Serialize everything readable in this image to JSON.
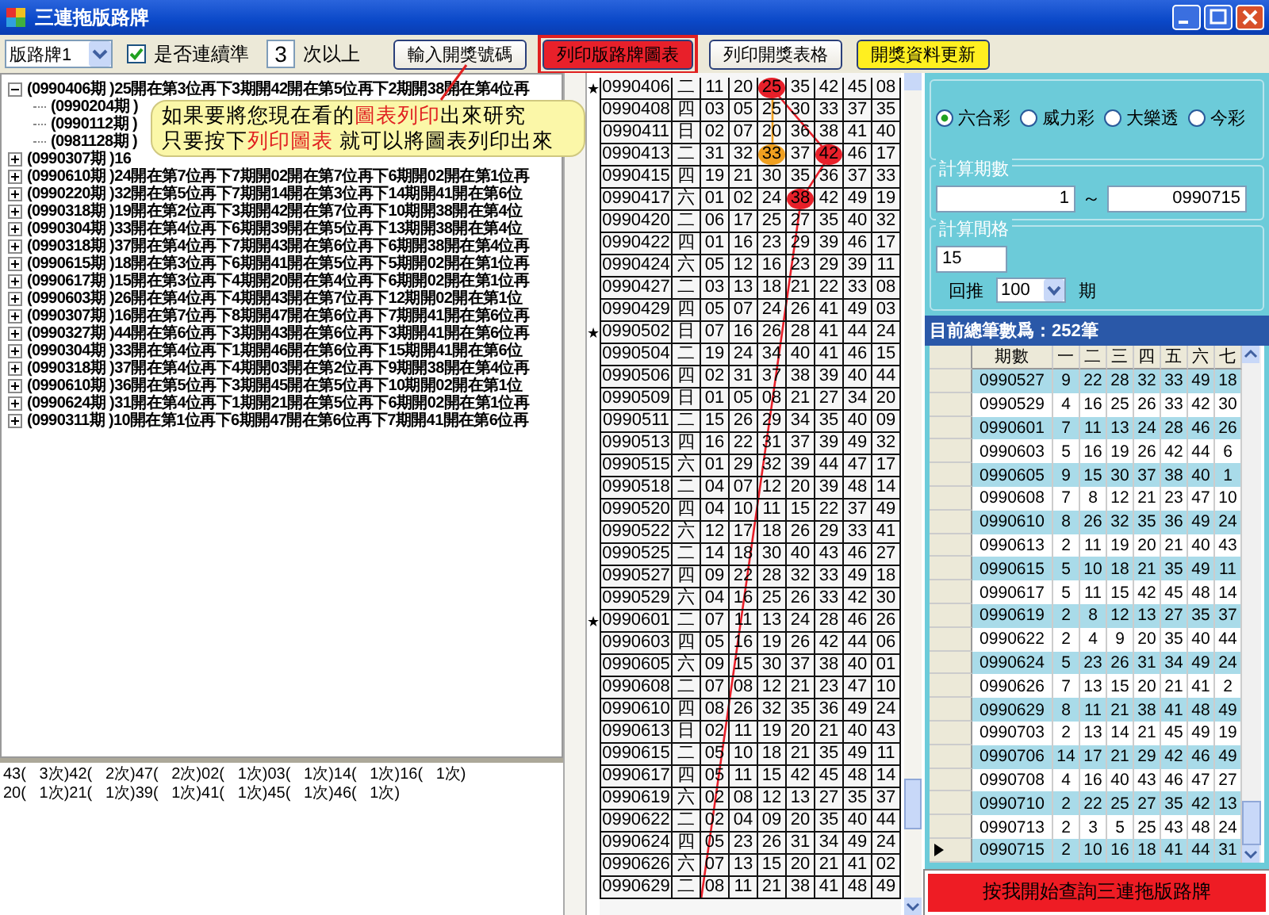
{
  "window": {
    "title": "三連拖版路牌"
  },
  "toolbar": {
    "dropdown": "版路牌1",
    "consecutive": {
      "label": "是否連續準",
      "checked": true
    },
    "count": "3",
    "count_suffix": "次以上",
    "buttons": [
      {
        "label": "輸入開獎號碼",
        "kind": "plain"
      },
      {
        "label": "列印版路牌圖表",
        "kind": "red"
      },
      {
        "label": "列印開獎表格",
        "kind": "plain"
      },
      {
        "label": "開獎資料更新",
        "kind": "yellow"
      }
    ]
  },
  "callout": {
    "lines": [
      [
        {
          "text": "如果要將您現在看的",
          "red": false
        },
        {
          "text": "圖表列印",
          "red": true
        },
        {
          "text": "出來研究",
          "red": false
        }
      ],
      [
        {
          "text": "只要按下",
          "red": false
        },
        {
          "text": "列印圖表",
          "red": true
        },
        {
          "text": " 就可以將圖表列印出來",
          "red": false
        }
      ]
    ]
  },
  "tree": [
    {
      "text": "(0990406期 )25開在第3位再下3期開42開在第5位再下2期開38開在第4位再",
      "expanded": true,
      "children": [
        {
          "text": "(0990204期 )"
        },
        {
          "text": "(0990112期 )"
        },
        {
          "text": "(0981128期 )"
        }
      ]
    },
    {
      "text": "(0990307期 )16",
      "expanded": false
    },
    {
      "text": "(0990610期 )24開在第7位再下7期開02開在第7位再下6期開02開在第1位再",
      "expanded": false
    },
    {
      "text": "(0990220期 )32開在第5位再下7期開14開在第3位再下14期開41開在第6位",
      "expanded": false
    },
    {
      "text": "(0990318期 )19開在第2位再下3期開42開在第7位再下10期開38開在第4位",
      "expanded": false
    },
    {
      "text": "(0990304期 )33開在第4位再下6期開39開在第5位再下13期開38開在第4位",
      "expanded": false
    },
    {
      "text": "(0990318期 )37開在第4位再下7期開43開在第6位再下6期開38開在第4位再",
      "expanded": false
    },
    {
      "text": "(0990615期 )18開在第3位再下6期開41開在第5位再下5期開02開在第1位再",
      "expanded": false
    },
    {
      "text": "(0990617期 )15開在第3位再下4期開20開在第4位再下6期開02開在第1位再",
      "expanded": false
    },
    {
      "text": "(0990603期 )26開在第4位再下4期開43開在第7位再下12期開02開在第1位",
      "expanded": false
    },
    {
      "text": "(0990307期 )16開在第7位再下8期開47開在第6位再下7期開41開在第6位再",
      "expanded": false
    },
    {
      "text": "(0990327期 )44開在第6位再下3期開43開在第6位再下3期開41開在第6位再",
      "expanded": false
    },
    {
      "text": "(0990304期 )33開在第4位再下1期開46開在第6位再下15期開41開在第6位",
      "expanded": false
    },
    {
      "text": "(0990318期 )37開在第4位再下4期開03開在第2位再下9期開38開在第4位再",
      "expanded": false
    },
    {
      "text": "(0990610期 )36開在第5位再下3期開45開在第5位再下10期開02開在第1位",
      "expanded": false
    },
    {
      "text": "(0990624期 )31開在第4位再下1期開21開在第5位再下6期開02開在第1位再",
      "expanded": false
    },
    {
      "text": "(0990311期 )10開在第1位再下6期開47開在第6位再下7期開41開在第6位再",
      "expanded": false
    }
  ],
  "summary": [
    "43(   3次)42(   2次)47(   2次)02(   1次)03(   1次)14(   1次)16(   1次)",
    "20(   1次)21(   1次)39(   1次)41(   1次)45(   1次)46(   1次)"
  ],
  "draws": {
    "rows": [
      {
        "marker": "★",
        "issue": "0990406",
        "weekday": "二",
        "numbers": [
          {
            "n": "11"
          },
          {
            "n": "20"
          },
          {
            "n": "25",
            "color": "#e8202a"
          },
          {
            "n": "35"
          },
          {
            "n": "42"
          },
          {
            "n": "45"
          },
          {
            "n": "08"
          }
        ]
      },
      {
        "issue": "0990408",
        "weekday": "四",
        "numbers": [
          {
            "n": "03"
          },
          {
            "n": "05"
          },
          {
            "n": "25"
          },
          {
            "n": "30"
          },
          {
            "n": "33"
          },
          {
            "n": "37"
          },
          {
            "n": "35"
          }
        ]
      },
      {
        "issue": "0990411",
        "weekday": "日",
        "numbers": [
          {
            "n": "02"
          },
          {
            "n": "07"
          },
          {
            "n": "20"
          },
          {
            "n": "36"
          },
          {
            "n": "38"
          },
          {
            "n": "41"
          },
          {
            "n": "40"
          }
        ]
      },
      {
        "issue": "0990413",
        "weekday": "二",
        "numbers": [
          {
            "n": "31"
          },
          {
            "n": "32"
          },
          {
            "n": "33",
            "color": "#f0a020"
          },
          {
            "n": "37"
          },
          {
            "n": "42",
            "color": "#e8202a"
          },
          {
            "n": "46"
          },
          {
            "n": "17"
          }
        ]
      },
      {
        "issue": "0990415",
        "weekday": "四",
        "numbers": [
          {
            "n": "19"
          },
          {
            "n": "21"
          },
          {
            "n": "30"
          },
          {
            "n": "35"
          },
          {
            "n": "36"
          },
          {
            "n": "37"
          },
          {
            "n": "33"
          }
        ]
      },
      {
        "issue": "0990417",
        "weekday": "六",
        "numbers": [
          {
            "n": "01"
          },
          {
            "n": "02"
          },
          {
            "n": "24"
          },
          {
            "n": "38",
            "color": "#e8202a"
          },
          {
            "n": "42"
          },
          {
            "n": "49"
          },
          {
            "n": "19"
          }
        ]
      },
      {
        "issue": "0990420",
        "weekday": "二",
        "numbers": [
          {
            "n": "06"
          },
          {
            "n": "17"
          },
          {
            "n": "25"
          },
          {
            "n": "27"
          },
          {
            "n": "35"
          },
          {
            "n": "40"
          },
          {
            "n": "32"
          }
        ]
      },
      {
        "issue": "0990422",
        "weekday": "四",
        "numbers": [
          {
            "n": "01"
          },
          {
            "n": "16"
          },
          {
            "n": "23"
          },
          {
            "n": "29"
          },
          {
            "n": "39"
          },
          {
            "n": "46"
          },
          {
            "n": "17"
          }
        ]
      },
      {
        "issue": "0990424",
        "weekday": "六",
        "numbers": [
          {
            "n": "05"
          },
          {
            "n": "12"
          },
          {
            "n": "16"
          },
          {
            "n": "23"
          },
          {
            "n": "29"
          },
          {
            "n": "39"
          },
          {
            "n": "11"
          }
        ]
      },
      {
        "issue": "0990427",
        "weekday": "二",
        "numbers": [
          {
            "n": "03"
          },
          {
            "n": "13"
          },
          {
            "n": "18"
          },
          {
            "n": "21"
          },
          {
            "n": "22"
          },
          {
            "n": "33"
          },
          {
            "n": "08"
          }
        ]
      },
      {
        "issue": "0990429",
        "weekday": "四",
        "numbers": [
          {
            "n": "05"
          },
          {
            "n": "07"
          },
          {
            "n": "24"
          },
          {
            "n": "26"
          },
          {
            "n": "41"
          },
          {
            "n": "49"
          },
          {
            "n": "03"
          }
        ]
      },
      {
        "marker": "★",
        "issue": "0990502",
        "weekday": "日",
        "numbers": [
          {
            "n": "07"
          },
          {
            "n": "16"
          },
          {
            "n": "26"
          },
          {
            "n": "28"
          },
          {
            "n": "41"
          },
          {
            "n": "44"
          },
          {
            "n": "24"
          }
        ]
      },
      {
        "issue": "0990504",
        "weekday": "二",
        "numbers": [
          {
            "n": "19"
          },
          {
            "n": "24"
          },
          {
            "n": "34"
          },
          {
            "n": "40"
          },
          {
            "n": "41"
          },
          {
            "n": "46"
          },
          {
            "n": "15"
          }
        ]
      },
      {
        "issue": "0990506",
        "weekday": "四",
        "numbers": [
          {
            "n": "02"
          },
          {
            "n": "31"
          },
          {
            "n": "37"
          },
          {
            "n": "38"
          },
          {
            "n": "39"
          },
          {
            "n": "40"
          },
          {
            "n": "44"
          }
        ]
      },
      {
        "issue": "0990509",
        "weekday": "日",
        "numbers": [
          {
            "n": "01"
          },
          {
            "n": "05"
          },
          {
            "n": "08"
          },
          {
            "n": "21"
          },
          {
            "n": "27"
          },
          {
            "n": "34"
          },
          {
            "n": "20"
          }
        ]
      },
      {
        "issue": "0990511",
        "weekday": "二",
        "numbers": [
          {
            "n": "15"
          },
          {
            "n": "26"
          },
          {
            "n": "29"
          },
          {
            "n": "34"
          },
          {
            "n": "35"
          },
          {
            "n": "40"
          },
          {
            "n": "09"
          }
        ]
      },
      {
        "issue": "0990513",
        "weekday": "四",
        "numbers": [
          {
            "n": "16"
          },
          {
            "n": "22"
          },
          {
            "n": "31"
          },
          {
            "n": "37"
          },
          {
            "n": "39"
          },
          {
            "n": "49"
          },
          {
            "n": "32"
          }
        ]
      },
      {
        "issue": "0990515",
        "weekday": "六",
        "numbers": [
          {
            "n": "01"
          },
          {
            "n": "29"
          },
          {
            "n": "32"
          },
          {
            "n": "39"
          },
          {
            "n": "44"
          },
          {
            "n": "47"
          },
          {
            "n": "17"
          }
        ]
      },
      {
        "issue": "0990518",
        "weekday": "二",
        "numbers": [
          {
            "n": "04"
          },
          {
            "n": "07"
          },
          {
            "n": "12"
          },
          {
            "n": "20"
          },
          {
            "n": "39"
          },
          {
            "n": "48"
          },
          {
            "n": "14"
          }
        ]
      },
      {
        "issue": "0990520",
        "weekday": "四",
        "numbers": [
          {
            "n": "04"
          },
          {
            "n": "10"
          },
          {
            "n": "11"
          },
          {
            "n": "15"
          },
          {
            "n": "22"
          },
          {
            "n": "37"
          },
          {
            "n": "49"
          }
        ]
      },
      {
        "issue": "0990522",
        "weekday": "六",
        "numbers": [
          {
            "n": "12"
          },
          {
            "n": "17"
          },
          {
            "n": "18"
          },
          {
            "n": "26"
          },
          {
            "n": "29"
          },
          {
            "n": "33"
          },
          {
            "n": "41"
          }
        ]
      },
      {
        "issue": "0990525",
        "weekday": "二",
        "numbers": [
          {
            "n": "14"
          },
          {
            "n": "18"
          },
          {
            "n": "30"
          },
          {
            "n": "40"
          },
          {
            "n": "43"
          },
          {
            "n": "46"
          },
          {
            "n": "27"
          }
        ]
      },
      {
        "issue": "0990527",
        "weekday": "四",
        "numbers": [
          {
            "n": "09"
          },
          {
            "n": "22"
          },
          {
            "n": "28"
          },
          {
            "n": "32"
          },
          {
            "n": "33"
          },
          {
            "n": "49"
          },
          {
            "n": "18"
          }
        ]
      },
      {
        "issue": "0990529",
        "weekday": "六",
        "numbers": [
          {
            "n": "04"
          },
          {
            "n": "16"
          },
          {
            "n": "25"
          },
          {
            "n": "26"
          },
          {
            "n": "33"
          },
          {
            "n": "42"
          },
          {
            "n": "30"
          }
        ]
      },
      {
        "marker": "★",
        "issue": "0990601",
        "weekday": "二",
        "numbers": [
          {
            "n": "07"
          },
          {
            "n": "11"
          },
          {
            "n": "13"
          },
          {
            "n": "24"
          },
          {
            "n": "28"
          },
          {
            "n": "46"
          },
          {
            "n": "26"
          }
        ]
      },
      {
        "issue": "0990603",
        "weekday": "四",
        "numbers": [
          {
            "n": "05"
          },
          {
            "n": "16"
          },
          {
            "n": "19"
          },
          {
            "n": "26"
          },
          {
            "n": "42"
          },
          {
            "n": "44"
          },
          {
            "n": "06"
          }
        ]
      },
      {
        "issue": "0990605",
        "weekday": "六",
        "numbers": [
          {
            "n": "09"
          },
          {
            "n": "15"
          },
          {
            "n": "30"
          },
          {
            "n": "37"
          },
          {
            "n": "38"
          },
          {
            "n": "40"
          },
          {
            "n": "01"
          }
        ]
      },
      {
        "issue": "0990608",
        "weekday": "二",
        "numbers": [
          {
            "n": "07"
          },
          {
            "n": "08"
          },
          {
            "n": "12"
          },
          {
            "n": "21"
          },
          {
            "n": "23"
          },
          {
            "n": "47"
          },
          {
            "n": "10"
          }
        ]
      },
      {
        "issue": "0990610",
        "weekday": "四",
        "numbers": [
          {
            "n": "08"
          },
          {
            "n": "26"
          },
          {
            "n": "32"
          },
          {
            "n": "35"
          },
          {
            "n": "36"
          },
          {
            "n": "49"
          },
          {
            "n": "24"
          }
        ]
      },
      {
        "issue": "0990613",
        "weekday": "日",
        "numbers": [
          {
            "n": "02"
          },
          {
            "n": "11"
          },
          {
            "n": "19"
          },
          {
            "n": "20"
          },
          {
            "n": "21"
          },
          {
            "n": "40"
          },
          {
            "n": "43"
          }
        ]
      },
      {
        "issue": "0990615",
        "weekday": "二",
        "numbers": [
          {
            "n": "05"
          },
          {
            "n": "10"
          },
          {
            "n": "18"
          },
          {
            "n": "21"
          },
          {
            "n": "35"
          },
          {
            "n": "49"
          },
          {
            "n": "11"
          }
        ]
      },
      {
        "issue": "0990617",
        "weekday": "四",
        "numbers": [
          {
            "n": "05"
          },
          {
            "n": "11"
          },
          {
            "n": "15"
          },
          {
            "n": "42"
          },
          {
            "n": "45"
          },
          {
            "n": "48"
          },
          {
            "n": "14"
          }
        ]
      },
      {
        "issue": "0990619",
        "weekday": "六",
        "numbers": [
          {
            "n": "02"
          },
          {
            "n": "08"
          },
          {
            "n": "12"
          },
          {
            "n": "13"
          },
          {
            "n": "27"
          },
          {
            "n": "35"
          },
          {
            "n": "37"
          }
        ]
      },
      {
        "issue": "0990622",
        "weekday": "二",
        "numbers": [
          {
            "n": "02"
          },
          {
            "n": "04"
          },
          {
            "n": "09"
          },
          {
            "n": "20"
          },
          {
            "n": "35"
          },
          {
            "n": "40"
          },
          {
            "n": "44"
          }
        ]
      },
      {
        "issue": "0990624",
        "weekday": "四",
        "numbers": [
          {
            "n": "05"
          },
          {
            "n": "23"
          },
          {
            "n": "26"
          },
          {
            "n": "31"
          },
          {
            "n": "34"
          },
          {
            "n": "49"
          },
          {
            "n": "24"
          }
        ]
      },
      {
        "issue": "0990626",
        "weekday": "六",
        "numbers": [
          {
            "n": "07"
          },
          {
            "n": "13"
          },
          {
            "n": "15"
          },
          {
            "n": "20"
          },
          {
            "n": "21"
          },
          {
            "n": "41"
          },
          {
            "n": "02"
          }
        ]
      },
      {
        "issue": "0990629",
        "weekday": "二",
        "numbers": [
          {
            "n": "08"
          },
          {
            "n": "11"
          },
          {
            "n": "21"
          },
          {
            "n": "38"
          },
          {
            "n": "41"
          },
          {
            "n": "48"
          },
          {
            "n": "49"
          }
        ]
      }
    ]
  },
  "panel": {
    "games": [
      {
        "label": "六合彩",
        "selected": true
      },
      {
        "label": "威力彩",
        "selected": false
      },
      {
        "label": "大樂透",
        "selected": false
      },
      {
        "label": "今彩",
        "selected": false
      }
    ],
    "range": {
      "title": "計算期數",
      "from": "1",
      "separator": "～",
      "to": "0990715"
    },
    "interval": {
      "title": "計算間格",
      "value": "15",
      "back_label": "回推",
      "back_value": "100",
      "unit": "期"
    },
    "total": "目前總筆數爲：252筆",
    "table": {
      "columns": [
        "期數",
        "一",
        "二",
        "三",
        "四",
        "五",
        "六",
        "七"
      ],
      "rows": [
        {
          "current": false,
          "cells": [
            "0990527",
            "9",
            "22",
            "28",
            "32",
            "33",
            "49",
            "18"
          ]
        },
        {
          "current": false,
          "cells": [
            "0990529",
            "4",
            "16",
            "25",
            "26",
            "33",
            "42",
            "30"
          ]
        },
        {
          "current": false,
          "cells": [
            "0990601",
            "7",
            "11",
            "13",
            "24",
            "28",
            "46",
            "26"
          ]
        },
        {
          "current": false,
          "cells": [
            "0990603",
            "5",
            "16",
            "19",
            "26",
            "42",
            "44",
            "6"
          ]
        },
        {
          "current": false,
          "cells": [
            "0990605",
            "9",
            "15",
            "30",
            "37",
            "38",
            "40",
            "1"
          ]
        },
        {
          "current": false,
          "cells": [
            "0990608",
            "7",
            "8",
            "12",
            "21",
            "23",
            "47",
            "10"
          ]
        },
        {
          "current": false,
          "cells": [
            "0990610",
            "8",
            "26",
            "32",
            "35",
            "36",
            "49",
            "24"
          ]
        },
        {
          "current": false,
          "cells": [
            "0990613",
            "2",
            "11",
            "19",
            "20",
            "21",
            "40",
            "43"
          ]
        },
        {
          "current": false,
          "cells": [
            "0990615",
            "5",
            "10",
            "18",
            "21",
            "35",
            "49",
            "11"
          ]
        },
        {
          "current": false,
          "cells": [
            "0990617",
            "5",
            "11",
            "15",
            "42",
            "45",
            "48",
            "14"
          ]
        },
        {
          "current": false,
          "cells": [
            "0990619",
            "2",
            "8",
            "12",
            "13",
            "27",
            "35",
            "37"
          ]
        },
        {
          "current": false,
          "cells": [
            "0990622",
            "2",
            "4",
            "9",
            "20",
            "35",
            "40",
            "44"
          ]
        },
        {
          "current": false,
          "cells": [
            "0990624",
            "5",
            "23",
            "26",
            "31",
            "34",
            "49",
            "24"
          ]
        },
        {
          "current": false,
          "cells": [
            "0990626",
            "7",
            "13",
            "15",
            "20",
            "21",
            "41",
            "2"
          ]
        },
        {
          "current": false,
          "cells": [
            "0990629",
            "8",
            "11",
            "21",
            "38",
            "41",
            "48",
            "49"
          ]
        },
        {
          "current": false,
          "cells": [
            "0990703",
            "2",
            "13",
            "14",
            "21",
            "45",
            "49",
            "19"
          ]
        },
        {
          "current": false,
          "cells": [
            "0990706",
            "14",
            "17",
            "21",
            "29",
            "42",
            "46",
            "49"
          ]
        },
        {
          "current": false,
          "cells": [
            "0990708",
            "4",
            "16",
            "40",
            "43",
            "46",
            "47",
            "27"
          ]
        },
        {
          "current": false,
          "cells": [
            "0990710",
            "2",
            "22",
            "25",
            "27",
            "35",
            "42",
            "13"
          ]
        },
        {
          "current": false,
          "cells": [
            "0990713",
            "2",
            "3",
            "5",
            "25",
            "43",
            "48",
            "24"
          ]
        },
        {
          "current": true,
          "cells": [
            "0990715",
            "2",
            "10",
            "16",
            "18",
            "41",
            "44",
            "31"
          ]
        }
      ]
    },
    "query_button": "按我開始查詢三連拖版路牌"
  }
}
